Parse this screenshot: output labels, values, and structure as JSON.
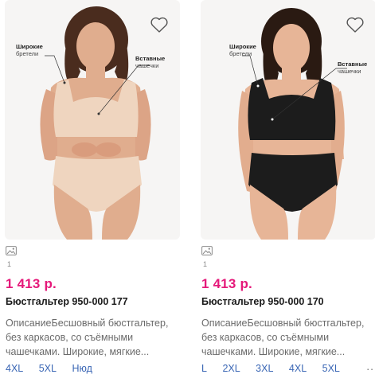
{
  "products": [
    {
      "annotation_straps": "Широкие",
      "annotation_straps_sub": "бретели",
      "annotation_cups": "Вставные",
      "annotation_cups_sub": "чашечки",
      "photo_count": "1",
      "price": "1 413 р.",
      "title": "Бюстгальтер 950-000 177",
      "description_lines": [
        "ОписаниеБесшовный бюстгальтер,",
        "без каркасов, со съёмными",
        "чашечками. Широкие, мягкие..."
      ],
      "sizes": [
        "4XL",
        "5XL",
        "Нюд"
      ],
      "colors": {
        "garment": "#efd5bf",
        "skin": "#e0ad8e",
        "hair": "#4a2c1e"
      }
    },
    {
      "annotation_straps": "Широкие",
      "annotation_straps_sub": "бретели",
      "annotation_cups": "Вставные",
      "annotation_cups_sub": "чашечки",
      "photo_count": "1",
      "price": "1 413 р.",
      "title": "Бюстгальтер 950-000 170",
      "description_lines": [
        "ОписаниеБесшовный бюстгальтер,",
        "без каркасов, со съёмными",
        "чашечками. Широкие, мягкие..."
      ],
      "sizes": [
        "L",
        "2XL",
        "3XL",
        "4XL",
        "5XL"
      ],
      "more": "..",
      "colors": {
        "garment": "#1c1c1c",
        "skin": "#e7b597",
        "hair": "#2a1a12"
      }
    }
  ],
  "icons": {
    "favorite": "heart-outline-icon",
    "gallery": "image-icon"
  },
  "accent": {
    "price": "#e5197a",
    "size_link": "#3b67b5"
  }
}
